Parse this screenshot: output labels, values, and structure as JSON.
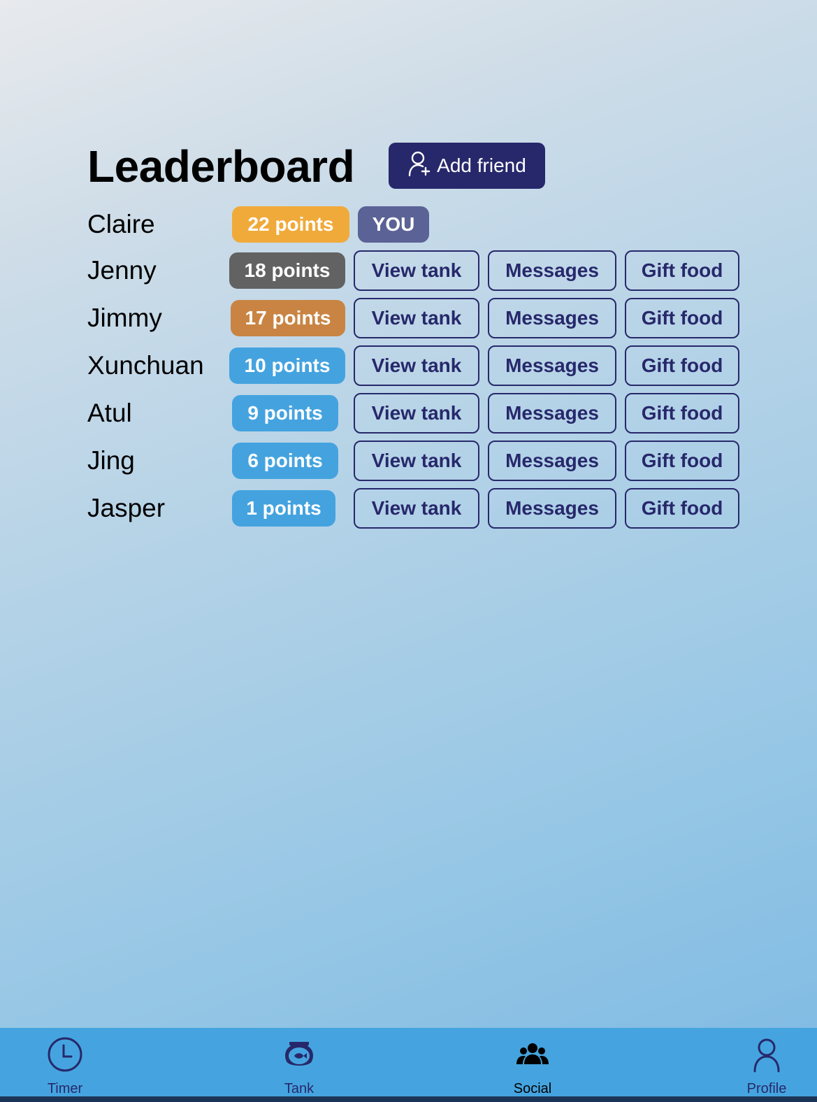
{
  "header": {
    "title": "Leaderboard",
    "add_friend_label": "Add friend"
  },
  "leaderboard": [
    {
      "name": "Claire",
      "points": "22 points",
      "tag": "YOU",
      "badge_color": "#f0aa3a"
    },
    {
      "name": "Jenny",
      "points": "18 points",
      "badge_color": "#626262"
    },
    {
      "name": "Jimmy",
      "points": "17 points",
      "badge_color": "#c98443"
    },
    {
      "name": "Xunchuan",
      "points": "10 points",
      "badge_color": "#44a3df"
    },
    {
      "name": "Atul",
      "points": "9 points",
      "badge_color": "#44a3df"
    },
    {
      "name": "Jing",
      "points": "6 points",
      "badge_color": "#44a3df"
    },
    {
      "name": "Jasper",
      "points": "1 points",
      "badge_color": "#44a3df"
    }
  ],
  "row_actions": {
    "view_tank": "View tank",
    "messages": "Messages",
    "gift_food": "Gift food"
  },
  "tabs": [
    {
      "label": "Timer",
      "icon": "clock-icon"
    },
    {
      "label": "Tank",
      "icon": "fishbowl-icon"
    },
    {
      "label": "Social",
      "icon": "group-icon",
      "active": true
    },
    {
      "label": "Profile",
      "icon": "person-icon"
    }
  ],
  "colors": {
    "accent": "#27286b",
    "tabbar": "#45a4df",
    "you_badge": "#5a6296"
  }
}
